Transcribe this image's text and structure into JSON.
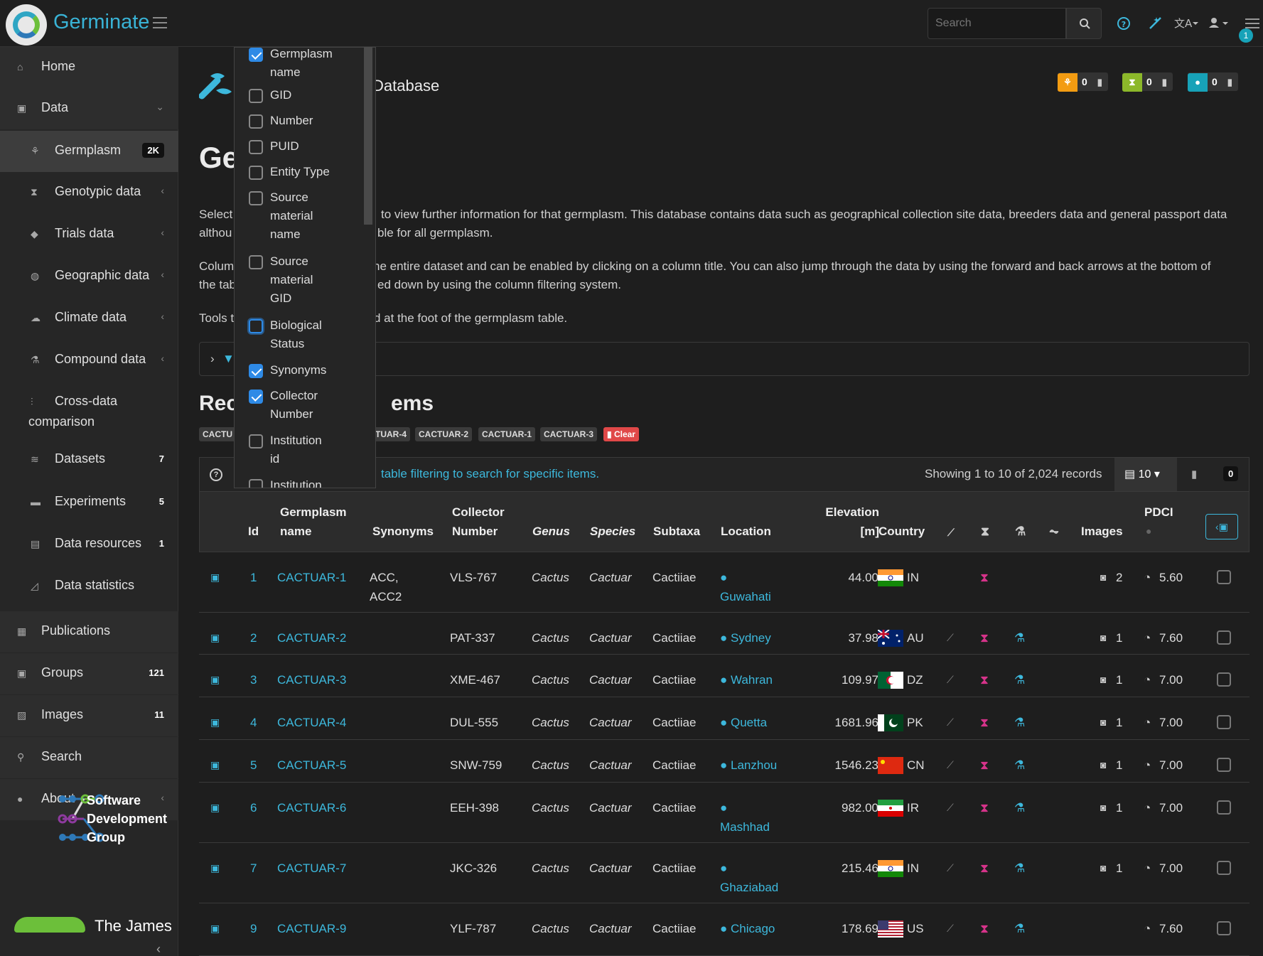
{
  "app": {
    "name": "Germinate",
    "page_heading": "Database",
    "h1_visible": "Ge"
  },
  "navbar": {
    "search_placeholder": "Search",
    "notification_count": "1"
  },
  "sidebar": {
    "items": [
      {
        "label": "Home",
        "icon": "home-icon"
      },
      {
        "label": "Data",
        "icon": "data-icon"
      },
      {
        "label": "Germplasm",
        "icon": "germplasm-icon",
        "count": "2K"
      },
      {
        "label": "Genotypic data",
        "icon": "hourglass-icon"
      },
      {
        "label": "Trials data",
        "icon": "tag-icon"
      },
      {
        "label": "Geographic data",
        "icon": "globe-icon"
      },
      {
        "label": "Climate data",
        "icon": "cloud-icon"
      },
      {
        "label": "Compound data",
        "icon": "flask-icon"
      },
      {
        "label": "Cross-data",
        "label2": "comparison",
        "icon": "sliders-icon"
      },
      {
        "label": "Datasets",
        "icon": "database-icon",
        "count": "7"
      },
      {
        "label": "Experiments",
        "icon": "folder-icon",
        "count": "5"
      },
      {
        "label": "Data resources",
        "icon": "file-icon",
        "count": "1"
      },
      {
        "label": "Data statistics",
        "icon": "chart-icon"
      },
      {
        "label": "Publications",
        "icon": "newspaper-icon"
      },
      {
        "label": "Groups",
        "icon": "group-icon",
        "count": "121"
      },
      {
        "label": "Images",
        "icon": "image-icon",
        "count": "11"
      },
      {
        "label": "Search",
        "icon": "search-icon"
      },
      {
        "label": "About",
        "icon": "info-icon"
      }
    ],
    "sdg": {
      "line1": "Software",
      "line2": "Development",
      "line3": "Group"
    },
    "hutton_text": "The James"
  },
  "stats": [
    {
      "icon": "germplasm-icon",
      "color": "#f39c12",
      "count": "0"
    },
    {
      "icon": "hourglass-icon",
      "color": "#8cb82a",
      "count": "0"
    },
    {
      "icon": "location-icon",
      "color": "#17a2b8",
      "count": "0"
    }
  ],
  "intro": {
    "p1_a": "Select",
    "p1_b": "to view further information for that germplasm. This database contains data such as geographical collection site data, breeders data and general passport data",
    "p1_c": "althou",
    "p1_d": "ble for all germplasm.",
    "p2_a": "Colum",
    "p2_b": "he entire dataset and can be enabled by clicking on a column title. You can also jump through the data by using the forward and back arrows at the bottom of",
    "p2_c": "the tab",
    "p2_d": "ed down by using the column filtering system.",
    "p3_a": "Tools t",
    "p3_b": "d at the foot of the germplasm table."
  },
  "recent": {
    "heading_a": "Rec",
    "heading_b": "ems",
    "tags": [
      "CACTU",
      "TUAR-4",
      "CACTUAR-2",
      "CACTUAR-1",
      "CACTUAR-3"
    ],
    "clear_label": "Clear"
  },
  "table_toolbar": {
    "hint": "table filtering to search for specific items.",
    "showing": "Showing 1 to 10 of 2,024 records",
    "per_page": "10",
    "selected_count": "0"
  },
  "columns": {
    "id": "Id",
    "germplasm": [
      "Germplasm",
      "name"
    ],
    "synonyms": "Synonyms",
    "collector": [
      "Collector",
      "Number"
    ],
    "genus": "Genus",
    "species": "Species",
    "subtaxa": "Subtaxa",
    "location": "Location",
    "elevation": [
      "Elevation",
      "[m]"
    ],
    "country": "Country",
    "images": "Images",
    "pdci": "PDCI"
  },
  "rows": [
    {
      "id": "1",
      "name": "CACTUAR-1",
      "syn1": "ACC,",
      "syn2": "ACC2",
      "collector": "VLS-767",
      "genus": "Cactus",
      "species": "Cactuar",
      "subtaxa": "Cactiiae",
      "location": "Guwahati",
      "elevation": "44.00",
      "country": "IN",
      "flag": "in",
      "images": "2",
      "pdci": "5.60",
      "pedigree": false,
      "compound": false
    },
    {
      "id": "2",
      "name": "CACTUAR-2",
      "syn1": "",
      "syn2": "",
      "collector": "PAT-337",
      "genus": "Cactus",
      "species": "Cactuar",
      "subtaxa": "Cactiiae",
      "location": "Sydney",
      "elevation": "37.98",
      "country": "AU",
      "flag": "au",
      "images": "1",
      "pdci": "7.60",
      "pedigree": true,
      "compound": true
    },
    {
      "id": "3",
      "name": "CACTUAR-3",
      "syn1": "",
      "syn2": "",
      "collector": "XME-467",
      "genus": "Cactus",
      "species": "Cactuar",
      "subtaxa": "Cactiiae",
      "location": "Wahran",
      "elevation": "109.97",
      "country": "DZ",
      "flag": "dz",
      "images": "1",
      "pdci": "7.00",
      "pedigree": true,
      "compound": true
    },
    {
      "id": "4",
      "name": "CACTUAR-4",
      "syn1": "",
      "syn2": "",
      "collector": "DUL-555",
      "genus": "Cactus",
      "species": "Cactuar",
      "subtaxa": "Cactiiae",
      "location": "Quetta",
      "elevation": "1681.96",
      "country": "PK",
      "flag": "pk",
      "images": "1",
      "pdci": "7.00",
      "pedigree": true,
      "compound": true
    },
    {
      "id": "5",
      "name": "CACTUAR-5",
      "syn1": "",
      "syn2": "",
      "collector": "SNW-759",
      "genus": "Cactus",
      "species": "Cactuar",
      "subtaxa": "Cactiiae",
      "location": "Lanzhou",
      "elevation": "1546.23",
      "country": "CN",
      "flag": "cn",
      "images": "1",
      "pdci": "7.00",
      "pedigree": true,
      "compound": true
    },
    {
      "id": "6",
      "name": "CACTUAR-6",
      "syn1": "",
      "syn2": "",
      "collector": "EEH-398",
      "genus": "Cactus",
      "species": "Cactuar",
      "subtaxa": "Cactiiae",
      "location": "Mashhad",
      "elevation": "982.00",
      "country": "IR",
      "flag": "ir",
      "images": "1",
      "pdci": "7.00",
      "pedigree": true,
      "compound": true
    },
    {
      "id": "7",
      "name": "CACTUAR-7",
      "syn1": "",
      "syn2": "",
      "collector": "JKC-326",
      "genus": "Cactus",
      "species": "Cactuar",
      "subtaxa": "Cactiiae",
      "location": "Ghaziabad",
      "elevation": "215.46",
      "country": "IN",
      "flag": "in",
      "images": "1",
      "pdci": "7.00",
      "pedigree": true,
      "compound": true
    },
    {
      "id": "9",
      "name": "CACTUAR-9",
      "syn1": "",
      "syn2": "",
      "collector": "YLF-787",
      "genus": "Cactus",
      "species": "Cactuar",
      "subtaxa": "Cactiiae",
      "location": "Chicago",
      "elevation": "178.69",
      "country": "US",
      "flag": "us",
      "images": "",
      "pdci": "7.60",
      "pedigree": true,
      "compound": true
    }
  ],
  "column_chooser": [
    {
      "lines": [
        "Germplasm",
        "name"
      ],
      "checked": true
    },
    {
      "lines": [
        "GID"
      ],
      "checked": false
    },
    {
      "lines": [
        "Number"
      ],
      "checked": false
    },
    {
      "lines": [
        "PUID"
      ],
      "checked": false
    },
    {
      "lines": [
        "Entity Type"
      ],
      "checked": false
    },
    {
      "lines": [
        "Source",
        "material",
        "name"
      ],
      "checked": false
    },
    {
      "lines": [
        "Source",
        "material",
        "GID"
      ],
      "checked": false
    },
    {
      "lines": [
        "Biological",
        "Status"
      ],
      "checked": false,
      "focused": true
    },
    {
      "lines": [
        "Synonyms"
      ],
      "checked": true
    },
    {
      "lines": [
        "Collector",
        "Number"
      ],
      "checked": true
    },
    {
      "lines": [
        "Institution",
        "id"
      ],
      "checked": false
    },
    {
      "lines": [
        "Institution"
      ],
      "checked": false
    }
  ]
}
